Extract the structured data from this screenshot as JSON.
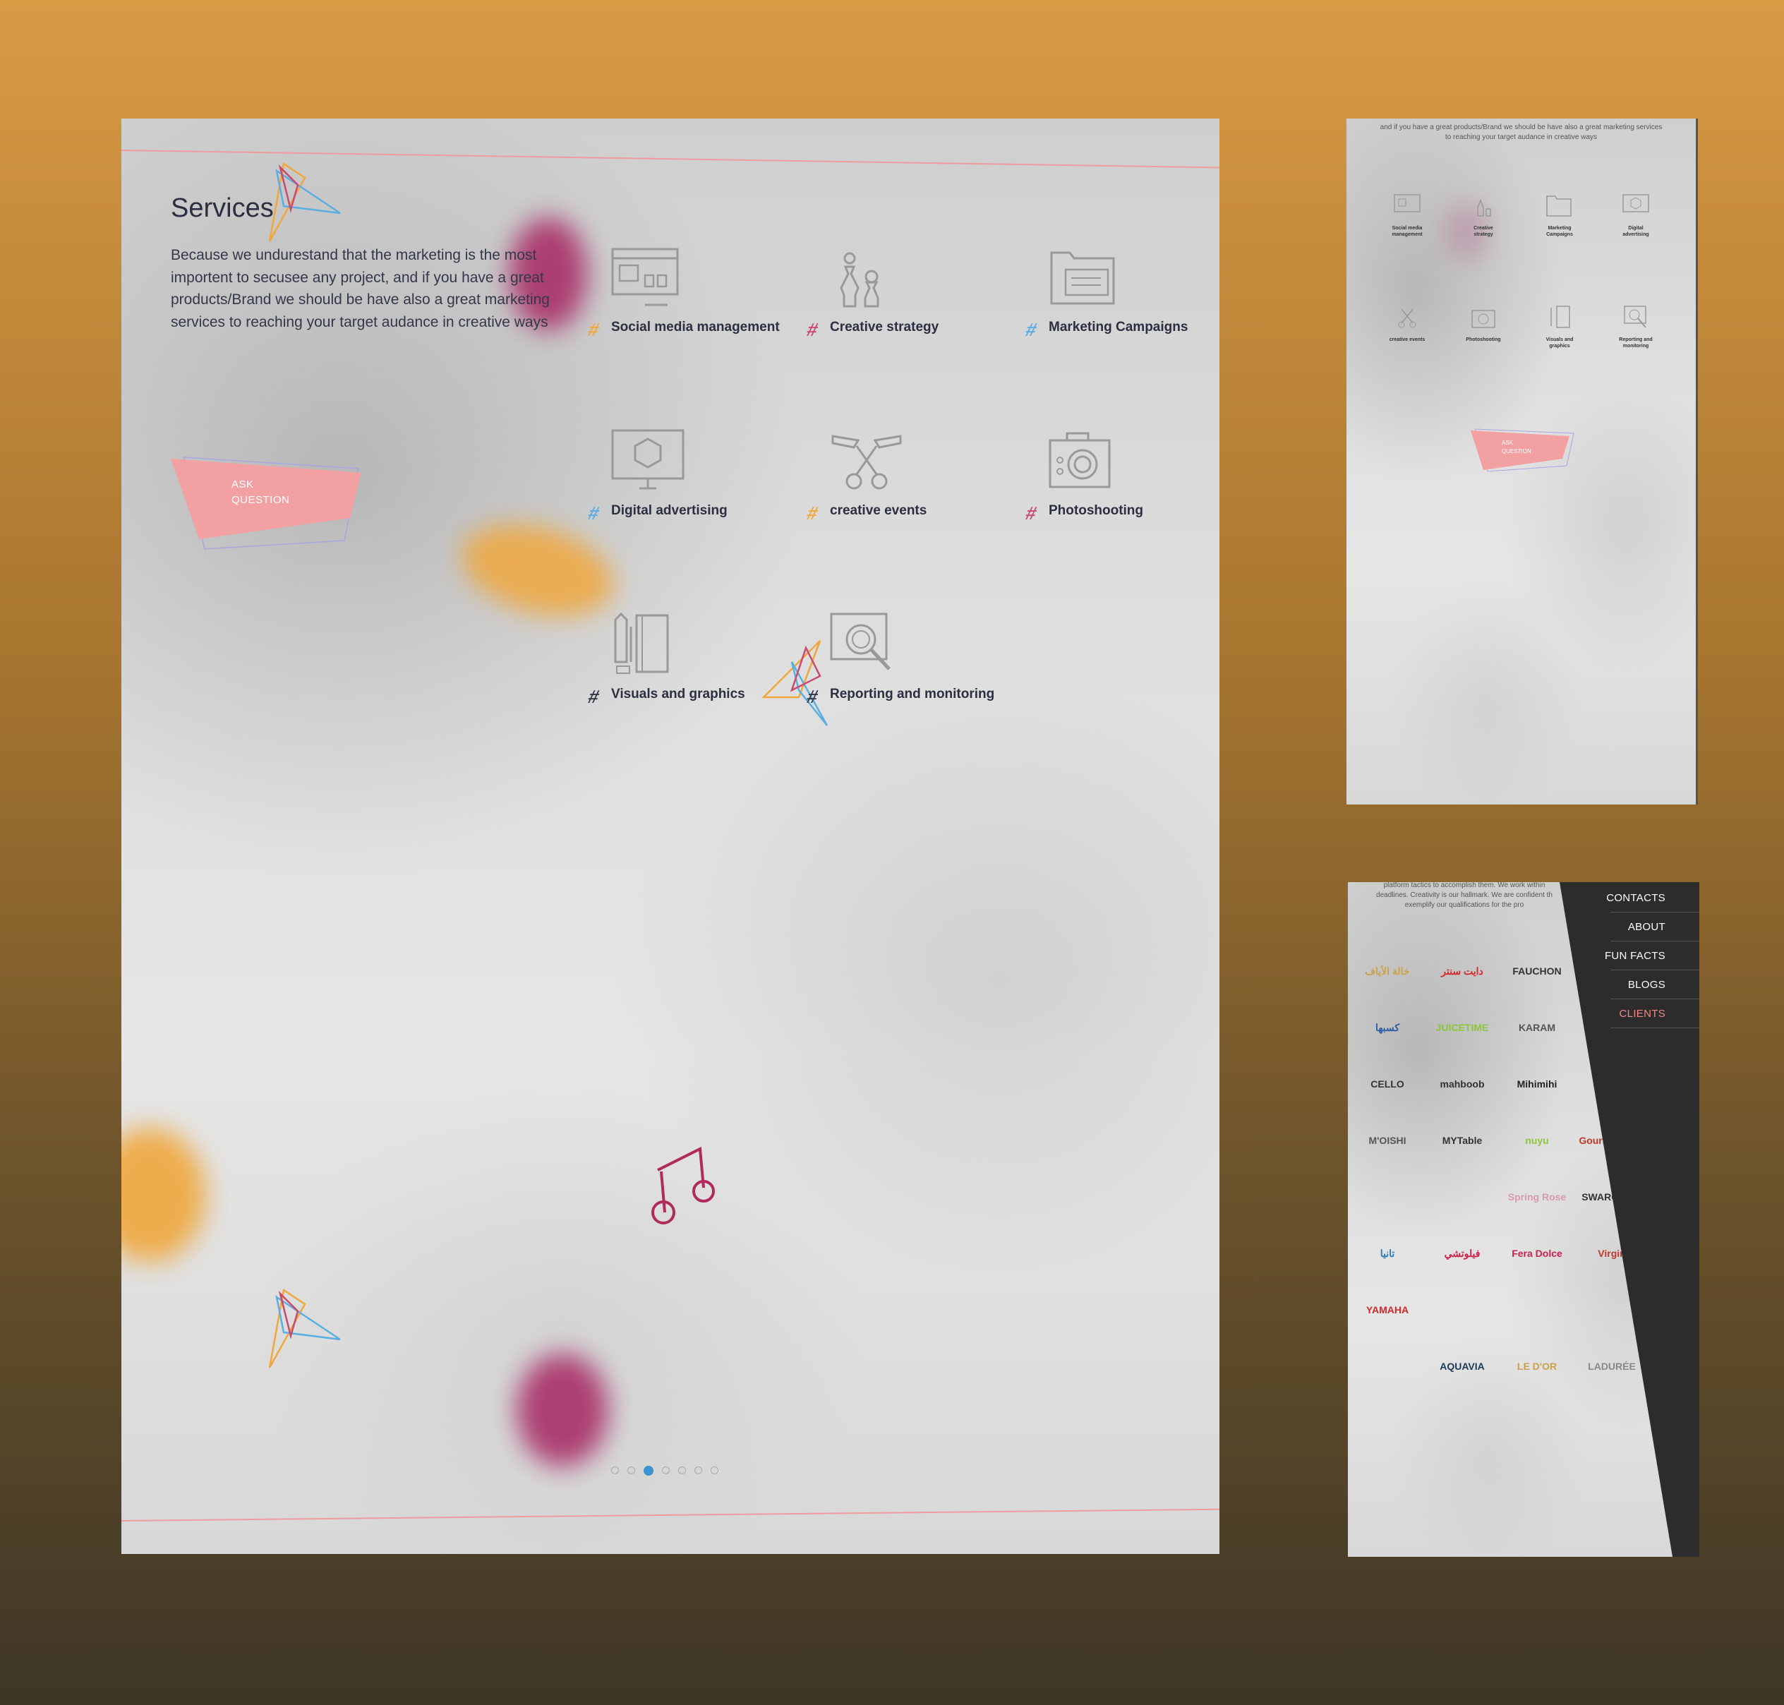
{
  "main": {
    "title": "Services",
    "description": "Because we undurestand that the marketing is the most importent to secusee any project, and if you have a great products/Brand we should be have also a great marketing services to reaching your target audance in creative ways",
    "ask_button": {
      "line1": "ASK",
      "line2": "QUESTION"
    },
    "services": [
      {
        "label": "Social media management",
        "icon": "social-media-icon",
        "hash_color": "#f0a73c"
      },
      {
        "label": "Creative strategy",
        "icon": "chess-icon",
        "hash_color": "#c94a70"
      },
      {
        "label": "Marketing Campaigns",
        "icon": "folder-icon",
        "hash_color": "#5aaee0"
      },
      {
        "label": "Digital advertising",
        "icon": "monitor-cube-icon",
        "hash_color": "#5aaee0"
      },
      {
        "label": "creative events",
        "icon": "scissors-ribbon-icon",
        "hash_color": "#f0a73c"
      },
      {
        "label": "Photoshooting",
        "icon": "camera-icon",
        "hash_color": "#c94a70"
      },
      {
        "label": "Visuals and graphics",
        "icon": "notebook-pencil-icon",
        "hash_color": "#333849"
      },
      {
        "label": "Reporting and monitoring",
        "icon": "magnifier-report-icon",
        "hash_color": "#333849"
      }
    ],
    "pagination": {
      "total": 7,
      "active": 2
    },
    "colors": {
      "accent_pink": "#f3a0a3",
      "accent_orange": "#f0a73c",
      "accent_magenta": "#a82f68",
      "accent_blue": "#5aaee0"
    }
  },
  "mobile1": {
    "intro_line1": "and if you have a great products/Brand we should be have also a great marketing services",
    "intro_line2": "to reaching your target audance in creative ways",
    "services": [
      {
        "line1": "Social media",
        "line2": "management"
      },
      {
        "line1": "Creative",
        "line2": "strategy"
      },
      {
        "line1": "Marketing",
        "line2": "Campaigns"
      },
      {
        "line1": "Digital",
        "line2": "advertising"
      },
      {
        "line1": "creative events",
        "line2": ""
      },
      {
        "line1": "Photoshooting",
        "line2": ""
      },
      {
        "line1": "Visuals and",
        "line2": "graphics"
      },
      {
        "line1": "Reporting and",
        "line2": "monitoring"
      }
    ],
    "ask_button": {
      "line1": "ASK",
      "line2": "QUESTION"
    }
  },
  "mobile2": {
    "intro_line1": "platform tactics to accomplish them. We work within",
    "intro_line2": "deadlines. Creativity is our hallmark. We are confident th",
    "intro_line3": "exemplify our qualifications for the pro",
    "nav": [
      {
        "label": "CONTACTS",
        "active": false
      },
      {
        "label": "ABOUT",
        "active": false
      },
      {
        "label": "FUN FACTS",
        "active": false
      },
      {
        "label": "BLOGS",
        "active": false
      },
      {
        "label": "CLIENTS",
        "active": true
      }
    ],
    "logos": [
      {
        "text": "خالة الأياف",
        "color": "#c9a24a"
      },
      {
        "text": "دايت سنتر",
        "color": "#d62828"
      },
      {
        "text": "FAUCHON",
        "color": "#333"
      },
      {
        "text": "",
        "color": "#888"
      },
      {
        "text": "كسبها",
        "color": "#2a5aa8"
      },
      {
        "text": "JUICETIME",
        "color": "#8cc63f"
      },
      {
        "text": "KARAM",
        "color": "#555"
      },
      {
        "text": "",
        "color": "#888"
      },
      {
        "text": "CELLO",
        "color": "#333"
      },
      {
        "text": "mahboob",
        "color": "#333"
      },
      {
        "text": "Mihimihi",
        "color": "#222"
      },
      {
        "text": "",
        "color": "#888"
      },
      {
        "text": "M'OISHI",
        "color": "#555"
      },
      {
        "text": "MYTable",
        "color": "#333"
      },
      {
        "text": "nuyu",
        "color": "#8cc63f"
      },
      {
        "text": "Gourmet Pure",
        "color": "#c0392b"
      },
      {
        "text": "",
        "color": "#7dbb3a"
      },
      {
        "text": "",
        "color": "#e7a0b0"
      },
      {
        "text": "Spring Rose",
        "color": "#d99ab0"
      },
      {
        "text": "SWAROVSKI",
        "color": "#333"
      },
      {
        "text": "تانيا",
        "color": "#2a7ac0"
      },
      {
        "text": "فيلوتشي",
        "color": "#d0204a"
      },
      {
        "text": "Fera Dolce",
        "color": "#d0204a"
      },
      {
        "text": "Virgin",
        "color": "#c0392b"
      },
      {
        "text": "YAMAHA",
        "color": "#d62828"
      },
      {
        "text": "",
        "color": "#3a9a3a"
      },
      {
        "text": "",
        "color": "#555"
      },
      {
        "text": "",
        "color": "#6a2a8a"
      },
      {
        "text": "",
        "color": "#3a9a3a"
      },
      {
        "text": "AQUAVIA",
        "color": "#1d3a5a"
      },
      {
        "text": "LE D'OR",
        "color": "#c9a24a"
      },
      {
        "text": "LADURÉE",
        "color": "#888"
      }
    ]
  }
}
